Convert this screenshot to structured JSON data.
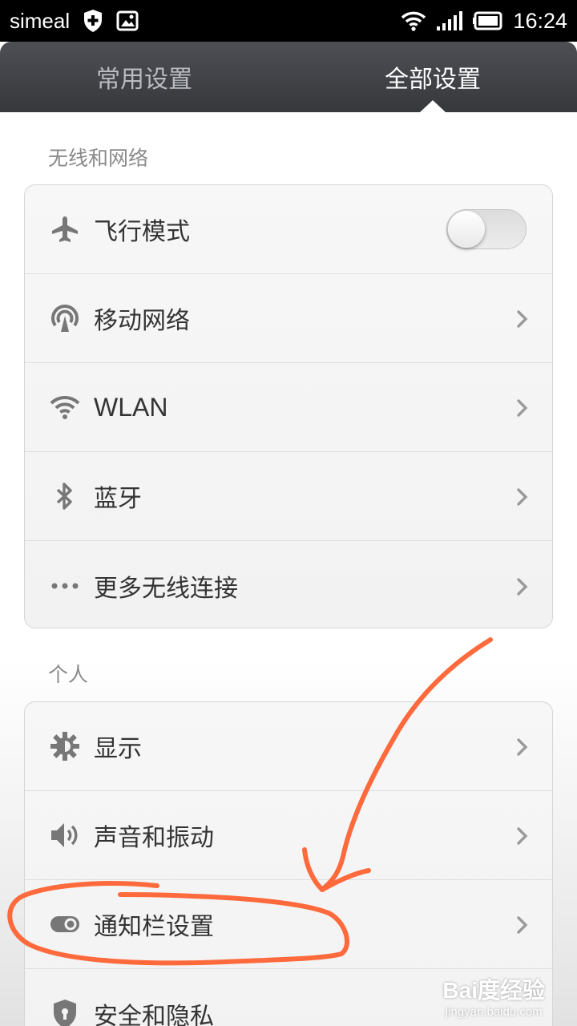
{
  "status_bar": {
    "carrier": "simeal",
    "time": "16:24",
    "icons": [
      "shield-plus-icon",
      "image-icon",
      "wifi-icon",
      "signal-icon",
      "battery-icon"
    ]
  },
  "tabs": [
    {
      "label": "常用设置",
      "active": false
    },
    {
      "label": "全部设置",
      "active": true
    }
  ],
  "sections": [
    {
      "header": "无线和网络",
      "items": [
        {
          "label": "飞行模式",
          "icon": "airplane-icon",
          "control": "toggle",
          "toggle_on": false
        },
        {
          "label": "移动网络",
          "icon": "antenna-icon",
          "control": "chevron"
        },
        {
          "label": "WLAN",
          "icon": "wifi-icon",
          "control": "chevron"
        },
        {
          "label": "蓝牙",
          "icon": "bluetooth-icon",
          "control": "chevron"
        },
        {
          "label": "更多无线连接",
          "icon": "more-dots-icon",
          "control": "chevron"
        }
      ]
    },
    {
      "header": "个人",
      "items": [
        {
          "label": "显示",
          "icon": "brightness-icon",
          "control": "chevron"
        },
        {
          "label": "声音和振动",
          "icon": "speaker-icon",
          "control": "chevron"
        },
        {
          "label": "通知栏设置",
          "icon": "toggle-switch-icon",
          "control": "chevron"
        },
        {
          "label": "安全和隐私",
          "icon": "shield-lock-icon",
          "control": "chevron"
        }
      ]
    }
  ],
  "watermark": {
    "logo": "Bai度经验",
    "url": "jingyan.baidu.com"
  },
  "colors": {
    "annotation": "#ff6a3d",
    "tabbar_top": "#4d4f54",
    "tabbar_bottom": "#36383c"
  }
}
